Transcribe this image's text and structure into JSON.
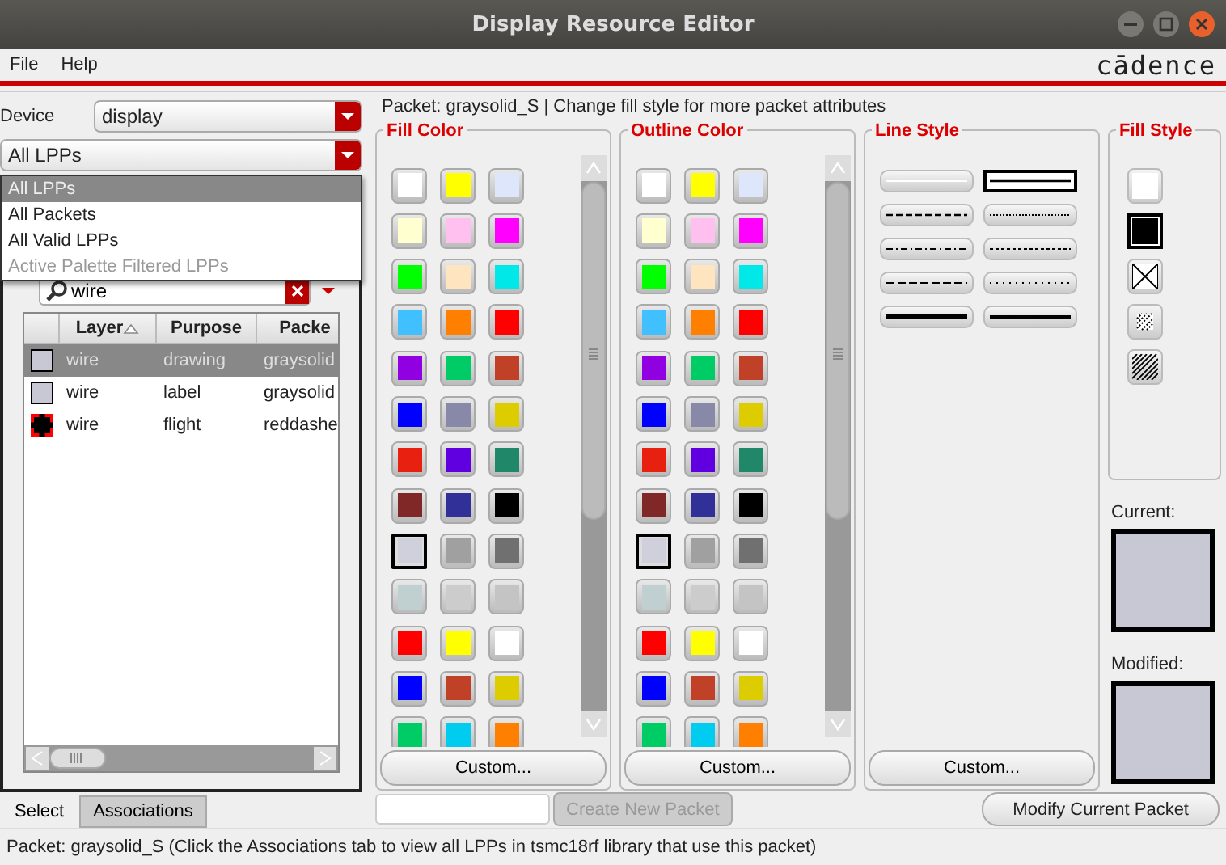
{
  "window": {
    "title": "Display Resource Editor"
  },
  "menu": [
    {
      "label": "File"
    },
    {
      "label": "Help"
    }
  ],
  "logo": "cādence",
  "device": {
    "label": "Device",
    "value": "display"
  },
  "filter": {
    "value": "All LPPs",
    "options": [
      {
        "label": "All LPPs",
        "selected": true,
        "disabled": false
      },
      {
        "label": "All Packets",
        "selected": false,
        "disabled": false
      },
      {
        "label": "All Valid LPPs",
        "selected": false,
        "disabled": false
      },
      {
        "label": "Active Palette Filtered LPPs",
        "selected": false,
        "disabled": true
      }
    ]
  },
  "search": {
    "value": "wire"
  },
  "table": {
    "columns": [
      {
        "label": "Layer",
        "sorted": true
      },
      {
        "label": "Purpose",
        "sorted": false
      },
      {
        "label": "Packe",
        "sorted": false
      }
    ],
    "rows": [
      {
        "layer": "wire",
        "purpose": "drawing",
        "packet": "graysolid",
        "selected": true,
        "kind": "solid",
        "color": "#c8c8d4"
      },
      {
        "layer": "wire",
        "purpose": "label",
        "packet": "graysolid",
        "selected": false,
        "kind": "solid",
        "color": "#c8c8d4"
      },
      {
        "layer": "wire",
        "purpose": "flight",
        "packet": "reddashe",
        "selected": false,
        "kind": "dashed",
        "color": "#ff0000"
      }
    ]
  },
  "tabs": [
    {
      "label": "Select",
      "selected": true
    },
    {
      "label": "Associations",
      "selected": false
    }
  ],
  "packet_info": "Packet: graysolid_S | Change fill style for more packet attributes",
  "fill_color": {
    "title": "Fill Color",
    "custom_button": "Custom...",
    "swatches": [
      {
        "color": "#ffffff",
        "selected": false
      },
      {
        "color": "#ffff00",
        "selected": false
      },
      {
        "color": "#dde6fa",
        "selected": false
      },
      {
        "color": "#ffffd0",
        "selected": false
      },
      {
        "color": "#ffc0f0",
        "selected": false
      },
      {
        "color": "#ff00ff",
        "selected": false
      },
      {
        "color": "#00ff00",
        "selected": false
      },
      {
        "color": "#ffe4c0",
        "selected": false
      },
      {
        "color": "#00e8e8",
        "selected": false
      },
      {
        "color": "#40c0ff",
        "selected": false
      },
      {
        "color": "#ff8000",
        "selected": false
      },
      {
        "color": "#ff0000",
        "selected": false
      },
      {
        "color": "#9000e0",
        "selected": false
      },
      {
        "color": "#00cc66",
        "selected": false
      },
      {
        "color": "#c04028",
        "selected": false
      },
      {
        "color": "#0000ff",
        "selected": false
      },
      {
        "color": "#8888a8",
        "selected": false
      },
      {
        "color": "#ddcc00",
        "selected": false
      },
      {
        "color": "#e82010",
        "selected": false
      },
      {
        "color": "#6000e0",
        "selected": false
      },
      {
        "color": "#208868",
        "selected": false
      },
      {
        "color": "#802828",
        "selected": false
      },
      {
        "color": "#303098",
        "selected": false
      },
      {
        "color": "#000000",
        "selected": false
      },
      {
        "color": "#d0d0dc",
        "selected": true
      },
      {
        "color": "#a0a0a0",
        "selected": false
      },
      {
        "color": "#707070",
        "selected": false
      },
      {
        "color": "#c0d0d0",
        "selected": false
      },
      {
        "color": "#cccccc",
        "selected": false
      },
      {
        "color": "#c4c4c4",
        "selected": false
      },
      {
        "color": "#ff0000",
        "selected": false
      },
      {
        "color": "#ffff00",
        "selected": false
      },
      {
        "color": "#ffffff",
        "selected": false
      },
      {
        "color": "#0000ff",
        "selected": false
      },
      {
        "color": "#c04028",
        "selected": false
      },
      {
        "color": "#ddcc00",
        "selected": false
      },
      {
        "color": "#00cc66",
        "selected": false
      },
      {
        "color": "#00ccf0",
        "selected": false
      },
      {
        "color": "#ff8000",
        "selected": false
      }
    ]
  },
  "outline_color": {
    "title": "Outline Color",
    "custom_button": "Custom...",
    "swatches": [
      {
        "color": "#ffffff",
        "selected": false
      },
      {
        "color": "#ffff00",
        "selected": false
      },
      {
        "color": "#dde6fa",
        "selected": false
      },
      {
        "color": "#ffffd0",
        "selected": false
      },
      {
        "color": "#ffc0f0",
        "selected": false
      },
      {
        "color": "#ff00ff",
        "selected": false
      },
      {
        "color": "#00ff00",
        "selected": false
      },
      {
        "color": "#ffe4c0",
        "selected": false
      },
      {
        "color": "#00e8e8",
        "selected": false
      },
      {
        "color": "#40c0ff",
        "selected": false
      },
      {
        "color": "#ff8000",
        "selected": false
      },
      {
        "color": "#ff0000",
        "selected": false
      },
      {
        "color": "#9000e0",
        "selected": false
      },
      {
        "color": "#00cc66",
        "selected": false
      },
      {
        "color": "#c04028",
        "selected": false
      },
      {
        "color": "#0000ff",
        "selected": false
      },
      {
        "color": "#8888a8",
        "selected": false
      },
      {
        "color": "#ddcc00",
        "selected": false
      },
      {
        "color": "#e82010",
        "selected": false
      },
      {
        "color": "#6000e0",
        "selected": false
      },
      {
        "color": "#208868",
        "selected": false
      },
      {
        "color": "#802828",
        "selected": false
      },
      {
        "color": "#303098",
        "selected": false
      },
      {
        "color": "#000000",
        "selected": false
      },
      {
        "color": "#d0d0dc",
        "selected": true
      },
      {
        "color": "#a0a0a0",
        "selected": false
      },
      {
        "color": "#707070",
        "selected": false
      },
      {
        "color": "#c0d0d0",
        "selected": false
      },
      {
        "color": "#cccccc",
        "selected": false
      },
      {
        "color": "#c4c4c4",
        "selected": false
      },
      {
        "color": "#ff0000",
        "selected": false
      },
      {
        "color": "#ffff00",
        "selected": false
      },
      {
        "color": "#ffffff",
        "selected": false
      },
      {
        "color": "#0000ff",
        "selected": false
      },
      {
        "color": "#c04028",
        "selected": false
      },
      {
        "color": "#ddcc00",
        "selected": false
      },
      {
        "color": "#00cc66",
        "selected": false
      },
      {
        "color": "#00ccf0",
        "selected": false
      },
      {
        "color": "#ff8000",
        "selected": false
      }
    ]
  },
  "line_style": {
    "title": "Line Style",
    "custom_button": "Custom...",
    "styles": [
      {
        "kind": "blank",
        "selected": false
      },
      {
        "kind": "solid",
        "selected": true
      },
      {
        "kind": "dashed",
        "selected": false
      },
      {
        "kind": "dotted",
        "selected": false
      },
      {
        "kind": "dashdot",
        "selected": false
      },
      {
        "kind": "finedash",
        "selected": false
      },
      {
        "kind": "longdash",
        "selected": false
      },
      {
        "kind": "sparsedot",
        "selected": false
      },
      {
        "kind": "thick",
        "selected": false
      },
      {
        "kind": "medium",
        "selected": false
      }
    ]
  },
  "fill_style": {
    "title": "Fill Style",
    "styles": [
      {
        "kind": "blank",
        "selected": false
      },
      {
        "kind": "solid",
        "selected": true
      },
      {
        "kind": "cross",
        "selected": false
      },
      {
        "kind": "sparsehatch",
        "selected": false
      },
      {
        "kind": "densehatch",
        "selected": false
      }
    ]
  },
  "current": {
    "label": "Current:",
    "color": "#c8c8d4"
  },
  "modified": {
    "label": "Modified:",
    "color": "#c8c8d4"
  },
  "new_packet": {
    "button": "Create New Packet",
    "disabled": true
  },
  "modify_button": "Modify Current Packet",
  "status_bar": "Packet: graysolid_S (Click the Associations tab to view all LPPs in tsmc18rf library that use this packet)"
}
